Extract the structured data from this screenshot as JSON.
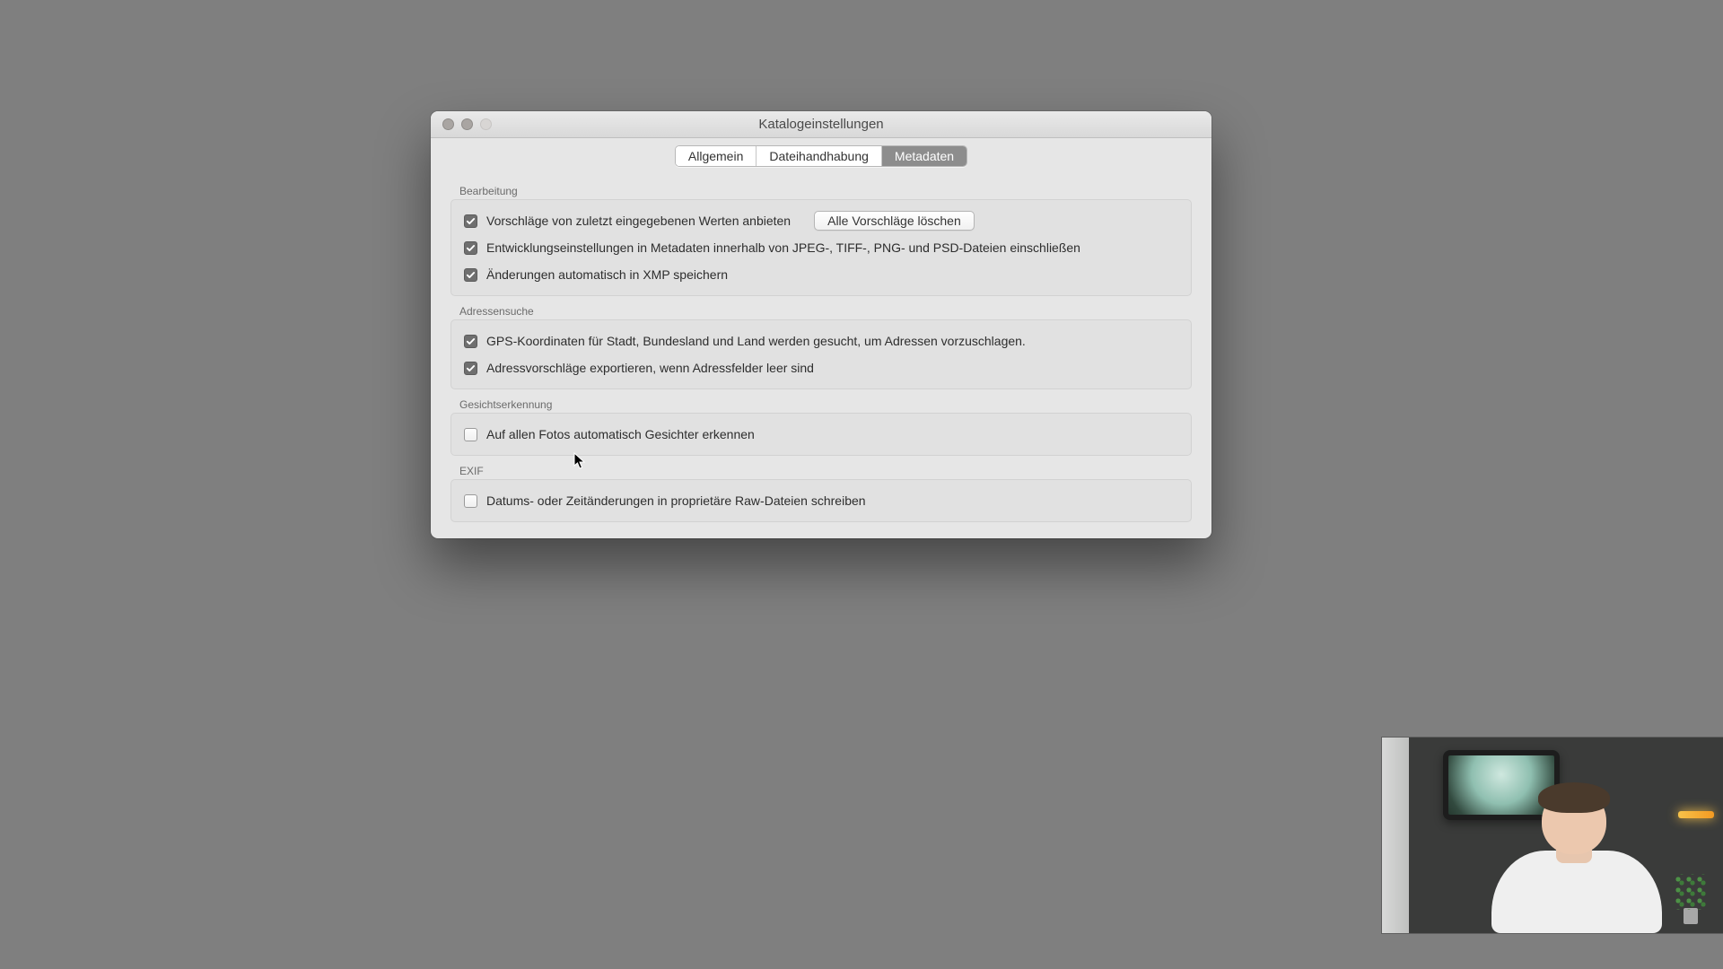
{
  "window": {
    "title": "Katalogeinstellungen"
  },
  "tabs": {
    "general": "Allgemein",
    "file_handling": "Dateihandhabung",
    "metadata": "Metadaten"
  },
  "editing": {
    "heading": "Bearbeitung",
    "offer_suggestions": "Vorschläge von zuletzt eingegebenen Werten anbieten",
    "clear_all_button": "Alle Vorschläge löschen",
    "include_dev_settings": "Entwicklungseinstellungen in Metadaten innerhalb von JPEG-, TIFF-, PNG- und PSD-Dateien einschließen",
    "auto_write_xmp": "Änderungen automatisch in XMP speichern"
  },
  "address": {
    "heading": "Adressensuche",
    "lookup_gps": "GPS-Koordinaten für Stadt, Bundesland und Land werden gesucht, um Adressen vorzuschlagen.",
    "export_suggestions": "Adressvorschläge exportieren, wenn Adressfelder leer sind"
  },
  "face": {
    "heading": "Gesichtserkennung",
    "auto_detect": "Auf allen Fotos automatisch Gesichter erkennen"
  },
  "exif": {
    "heading": "EXIF",
    "write_date_changes": "Datums- oder Zeitänderungen in proprietäre Raw-Dateien schreiben"
  }
}
